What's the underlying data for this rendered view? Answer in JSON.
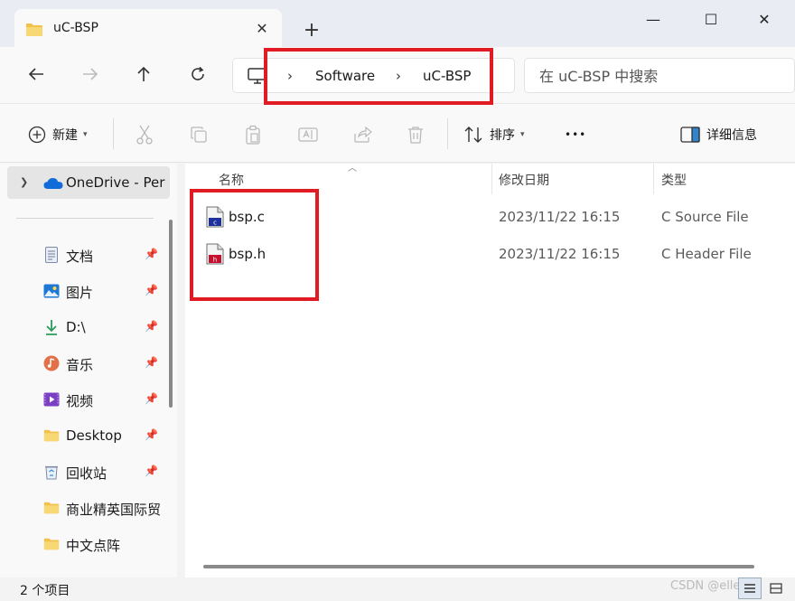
{
  "window": {
    "tab_title": "uC-BSP",
    "new_tab_symbol": "+",
    "close_tab_symbol": "✕",
    "minimize_symbol": "—",
    "maximize_symbol": "☐",
    "close_symbol": "✕"
  },
  "address": {
    "breadcrumbs": [
      "Software",
      "uC-BSP"
    ],
    "separator": "›",
    "search_placeholder": "在 uC-BSP 中搜索"
  },
  "toolbar": {
    "new_label": "新建",
    "sort_label": "排序",
    "more_symbol": "•••",
    "details_label": "详细信息"
  },
  "sidebar": {
    "onedrive_label": "OneDrive - Per",
    "items": [
      {
        "label": "文档",
        "icon": "document-icon",
        "pinned": true
      },
      {
        "label": "图片",
        "icon": "pictures-icon",
        "pinned": true
      },
      {
        "label": "D:\\",
        "icon": "download-arrow-icon",
        "pinned": true
      },
      {
        "label": "音乐",
        "icon": "music-icon",
        "pinned": true
      },
      {
        "label": "视频",
        "icon": "video-icon",
        "pinned": true
      },
      {
        "label": "Desktop",
        "icon": "folder-icon",
        "pinned": true
      },
      {
        "label": "回收站",
        "icon": "recycle-bin-icon",
        "pinned": true
      },
      {
        "label": "商业精英国际贸",
        "icon": "folder-icon",
        "pinned": false
      },
      {
        "label": "中文点阵",
        "icon": "folder-icon",
        "pinned": false
      }
    ]
  },
  "content": {
    "columns": [
      "名称",
      "修改日期",
      "类型"
    ],
    "files": [
      {
        "name": "bsp.c",
        "date": "2023/11/22 16:15",
        "type": "C Source File",
        "badge": "c"
      },
      {
        "name": "bsp.h",
        "date": "2023/11/22 16:15",
        "type": "C Header File",
        "badge": "h"
      }
    ]
  },
  "status": {
    "count": "2 个项目",
    "watermark": "CSDN @ellen"
  },
  "colors": {
    "highlight": "#e01b24",
    "accent": "#0067c0"
  }
}
